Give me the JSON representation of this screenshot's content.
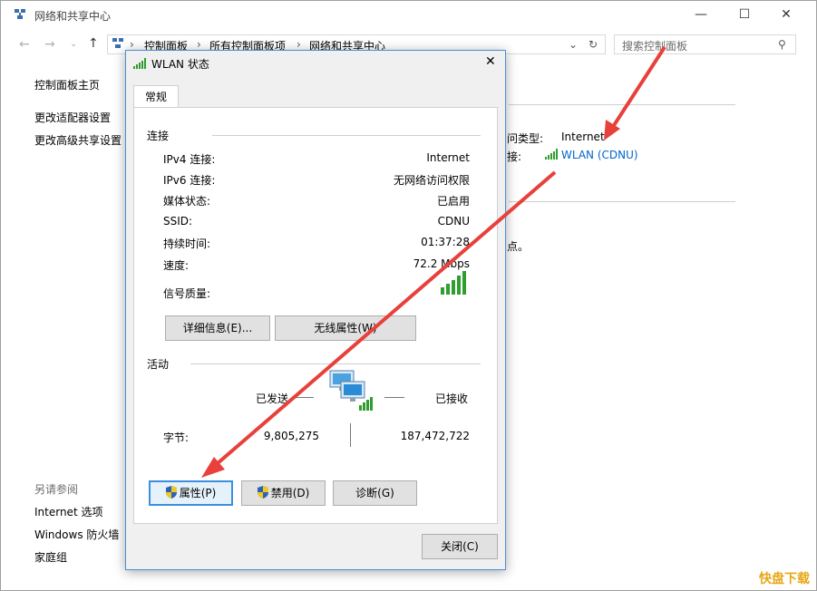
{
  "window": {
    "title": "网络和共享中心",
    "minimize": "—",
    "maximize": "☐",
    "close": "✕"
  },
  "address": {
    "crumbs": [
      "控制面板",
      "所有控制面板项",
      "网络和共享中心"
    ],
    "search_placeholder": "搜索控制面板"
  },
  "sidebar": {
    "home": "控制面板主页",
    "items": [
      "更改适配器设置",
      "更改高级共享设置"
    ],
    "see_also_title": "另请参阅",
    "see_also": [
      "Internet 选项",
      "Windows 防火墙",
      "家庭组"
    ]
  },
  "main": {
    "access_type_label": "问类型:",
    "access_type_value": "Internet",
    "connections_label": "接:",
    "connection_link": "WLAN (CDNU)",
    "partial_text": "点。"
  },
  "dialog": {
    "title": "WLAN 状态",
    "tab": "常规",
    "connection_section": "连接",
    "rows": [
      {
        "label": "IPv4 连接:",
        "value": "Internet"
      },
      {
        "label": "IPv6 连接:",
        "value": "无网络访问权限"
      },
      {
        "label": "媒体状态:",
        "value": "已启用"
      },
      {
        "label": "SSID:",
        "value": "CDNU"
      },
      {
        "label": "持续时间:",
        "value": "01:37:28"
      },
      {
        "label": "速度:",
        "value": "72.2 Mbps"
      }
    ],
    "signal_label": "信号质量:",
    "signal_bars": 5,
    "details_button": "详细信息(E)...",
    "wireless_button": "无线属性(W)",
    "activity_section": "活动",
    "sent_label": "已发送",
    "received_label": "已接收",
    "bytes_label": "字节:",
    "bytes_sent": "9,805,275",
    "bytes_received": "187,472,722",
    "properties_button": "属性(P)",
    "disable_button": "禁用(D)",
    "diagnose_button": "诊断(G)",
    "close_button": "关闭(C)"
  },
  "watermark": "快盘下载",
  "colors": {
    "accent_blue": "#0066cc",
    "annotation_red": "#e8403a",
    "signal_green": "#2f9e2f"
  }
}
